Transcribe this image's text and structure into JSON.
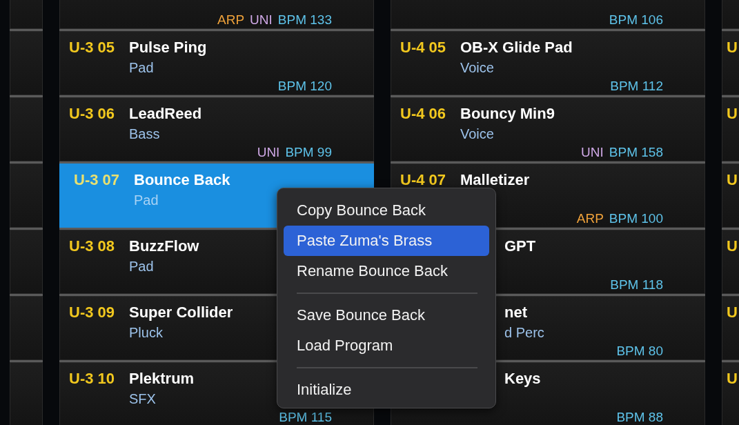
{
  "columns": [
    {
      "cells": [
        {
          "kind": "normal",
          "selected": false,
          "tags": [
            {
              "kind": "arp",
              "text": "ARP"
            },
            {
              "kind": "uni",
              "text": "UNI"
            },
            {
              "kind": "bpm",
              "text": "BPM 133"
            }
          ]
        },
        {
          "kind": "normal",
          "selected": false,
          "code": "U-3 05",
          "name": "Pulse Ping",
          "category": "Pad",
          "tags": [
            {
              "kind": "bpm",
              "text": "BPM 120"
            }
          ]
        },
        {
          "kind": "normal",
          "selected": false,
          "code": "U-3 06",
          "name": "LeadReed",
          "category": "Bass",
          "tags": [
            {
              "kind": "uni",
              "text": "UNI"
            },
            {
              "kind": "bpm",
              "text": "BPM 99"
            }
          ]
        },
        {
          "kind": "normal",
          "selected": true,
          "code": "U-3 07",
          "name": "Bounce Back",
          "category": "Pad"
        },
        {
          "kind": "normal",
          "selected": false,
          "code": "U-3 08",
          "name": "BuzzFlow",
          "category": "Pad"
        },
        {
          "kind": "normal",
          "selected": false,
          "code": "U-3 09",
          "name": "Super Collider",
          "category": "Pluck"
        },
        {
          "kind": "normal",
          "selected": false,
          "code": "U-3 10",
          "name": "Plektrum",
          "category": "SFX",
          "tags": [
            {
              "kind": "bpm",
              "text": "BPM 115"
            }
          ]
        }
      ]
    },
    {
      "cells": [
        {
          "kind": "normal",
          "selected": false,
          "tags": [
            {
              "kind": "bpm",
              "text": "BPM 106"
            }
          ]
        },
        {
          "kind": "normal",
          "selected": false,
          "code": "U-4 05",
          "name": "OB-X  Glide  Pad",
          "category": "Voice",
          "tags": [
            {
              "kind": "bpm",
              "text": "BPM 112"
            }
          ]
        },
        {
          "kind": "normal",
          "selected": false,
          "code": "U-4 06",
          "name": "Bouncy Min9",
          "category": "Voice",
          "tags": [
            {
              "kind": "uni",
              "text": "UNI"
            },
            {
              "kind": "bpm",
              "text": "BPM 158"
            }
          ]
        },
        {
          "kind": "normal",
          "selected": false,
          "code": "U-4 07",
          "name": "Malletizer",
          "tags": [
            {
              "kind": "arp",
              "text": "ARP"
            },
            {
              "kind": "bpm",
              "text": "BPM 100"
            }
          ]
        },
        {
          "kind": "covered",
          "selected": false,
          "name": "GPT",
          "tags": [
            {
              "kind": "bpm",
              "text": "BPM 118"
            }
          ]
        },
        {
          "kind": "covered",
          "selected": false,
          "name": "net",
          "category": "d Perc",
          "tags": [
            {
              "kind": "bpm",
              "text": "BPM 80"
            }
          ]
        },
        {
          "kind": "covered",
          "selected": false,
          "name": "Keys",
          "tags": [
            {
              "kind": "bpm",
              "text": "BPM 88"
            }
          ]
        }
      ]
    },
    {
      "cells": [
        {
          "kind": "normal",
          "selected": false
        },
        {
          "kind": "normal",
          "selected": false,
          "code": "U"
        },
        {
          "kind": "normal",
          "selected": false,
          "code": "U"
        },
        {
          "kind": "normal",
          "selected": false,
          "code": "U"
        },
        {
          "kind": "normal",
          "selected": false,
          "code": "U"
        },
        {
          "kind": "normal",
          "selected": false,
          "code": "U"
        },
        {
          "kind": "normal",
          "selected": false,
          "code": "U"
        }
      ]
    }
  ],
  "context_menu": {
    "items": [
      {
        "kind": "item",
        "label": "Copy Bounce Back",
        "selected": false
      },
      {
        "kind": "item",
        "label": "Paste Zuma's Brass",
        "selected": true
      },
      {
        "kind": "item",
        "label": "Rename Bounce Back",
        "selected": false
      },
      {
        "kind": "separator"
      },
      {
        "kind": "item",
        "label": "Save Bounce Back",
        "selected": false
      },
      {
        "kind": "item",
        "label": "Load Program",
        "selected": false
      },
      {
        "kind": "separator"
      },
      {
        "kind": "item",
        "label": "Initialize",
        "selected": false
      }
    ]
  }
}
